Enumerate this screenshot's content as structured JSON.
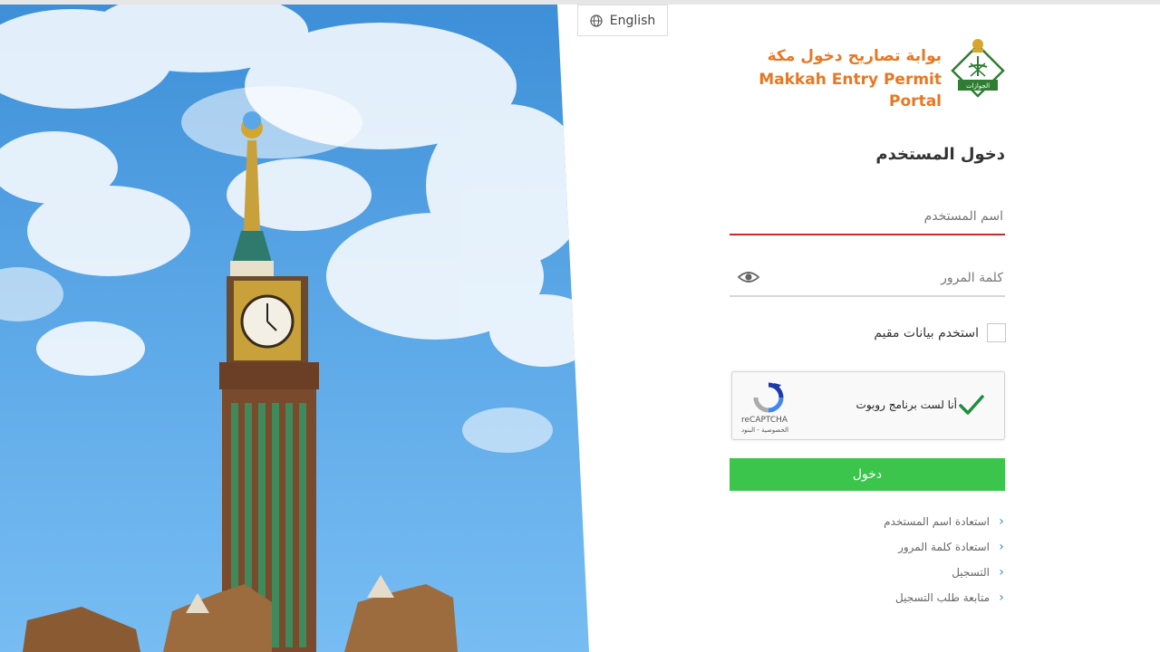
{
  "language_button": {
    "label": "English",
    "icon": "globe-icon"
  },
  "brand": {
    "title_ar": "بوابة تصاريح دخول مكة",
    "title_en": "Makkah Entry Permit Portal",
    "logo_text": "الجوازات",
    "color": "#e87722"
  },
  "login": {
    "title": "دخول المستخدم",
    "username_placeholder": "اسم المستخدم",
    "password_placeholder": "كلمة المرور",
    "resident_checkbox_label": "استخدم بيانات مقيم",
    "submit_label": "دخول",
    "submit_color": "#3bc54c"
  },
  "recaptcha": {
    "label": "أنا لست برنامج روبوت",
    "brand": "reCAPTCHA",
    "privacy_terms": "الخصوصية - البنود",
    "checked": true
  },
  "links": [
    {
      "label": "استعادة اسم المستخدم"
    },
    {
      "label": "استعادة كلمة المرور"
    },
    {
      "label": "التسجيل"
    },
    {
      "label": "متابعة طلب التسجيل"
    }
  ]
}
